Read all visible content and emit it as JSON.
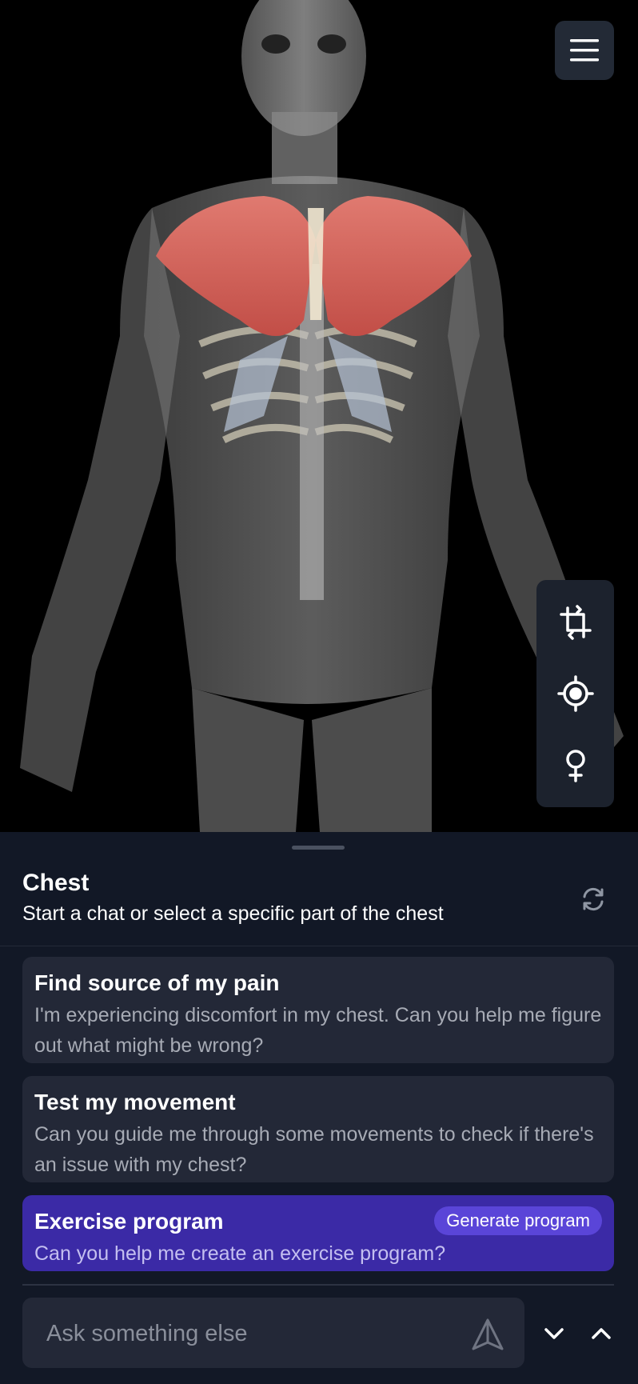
{
  "app": {
    "menu_icon": "hamburger-menu-icon",
    "viewer_tools": [
      {
        "name": "rotate-crop-icon"
      },
      {
        "name": "focus-target-icon"
      },
      {
        "name": "female-symbol-icon"
      }
    ]
  },
  "panel": {
    "title": "Chest",
    "subtitle": "Start a chat or select a specific part of the chest",
    "refresh_icon": "refresh-icon",
    "suggestions": [
      {
        "title": "Find source of my pain",
        "text": "I'm experiencing discomfort in my chest. Can you help me figure out what might be wrong?"
      },
      {
        "title": "Test my movement",
        "text": "Can you guide me through some movements to check if there's an issue with my chest?"
      },
      {
        "title": "Exercise program",
        "text": "Can you help me create an exercise program?",
        "badge": "Generate program"
      }
    ]
  },
  "composer": {
    "placeholder": "Ask something else",
    "send_icon": "send-icon",
    "collapse_icon": "chevron-down-icon",
    "expand_icon": "chevron-up-icon"
  },
  "colors": {
    "sheet_background": "#121826",
    "card_background": "#232837",
    "primary_card": "#3b2aa6",
    "badge": "#5a45d8",
    "muscle_highlight": "#d9645a"
  }
}
